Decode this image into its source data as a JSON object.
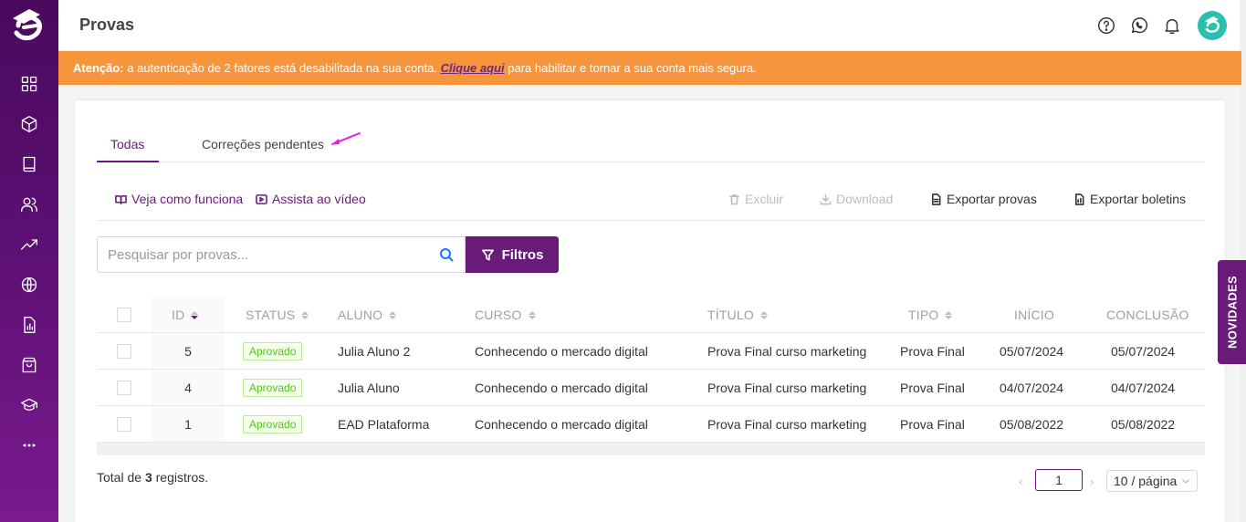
{
  "header": {
    "title": "Provas",
    "icons": [
      "help-circle-icon",
      "whatsapp-icon",
      "bell-icon"
    ]
  },
  "sidebar": {
    "items": [
      {
        "icon": "dashboard-icon"
      },
      {
        "icon": "cube-icon"
      },
      {
        "icon": "book-icon"
      },
      {
        "icon": "users-icon"
      },
      {
        "icon": "trend-up-icon"
      },
      {
        "icon": "globe-icon"
      },
      {
        "icon": "report-icon"
      },
      {
        "icon": "shopping-bag-icon"
      },
      {
        "icon": "graduation-cap-icon"
      },
      {
        "icon": "more-icon"
      }
    ]
  },
  "alert": {
    "label": "Atenção:",
    "text": "a autenticação de 2 fatores está desabilitada na sua conta.",
    "link": "Clique aqui",
    "suffix": "para habilitar e tornar a sua conta mais segura."
  },
  "tabs": {
    "all": "Todas",
    "pending": "Correções pendentes"
  },
  "toolbar": {
    "how_it_works": "Veja como funciona",
    "watch_video": "Assista ao vídeo",
    "delete": "Excluir",
    "download": "Download",
    "export_exams": "Exportar provas",
    "export_reports": "Exportar boletins"
  },
  "search": {
    "placeholder": "Pesquisar por provas...",
    "filter_label": "Filtros"
  },
  "table": {
    "columns": {
      "id": "ID",
      "status": "STATUS",
      "aluno": "ALUNO",
      "curso": "CURSO",
      "titulo": "TÍTULO",
      "tipo": "TIPO",
      "inicio": "INÍCIO",
      "conclusao": "CONCLUSÃO"
    },
    "rows": [
      {
        "id": "5",
        "status": "Aprovado",
        "aluno": "Julia Aluno 2",
        "curso": "Conhecendo o mercado digital",
        "titulo": "Prova Final curso marketing",
        "tipo": "Prova Final",
        "inicio": "05/07/2024",
        "conclusao": "05/07/2024"
      },
      {
        "id": "4",
        "status": "Aprovado",
        "aluno": "Julia Aluno",
        "curso": "Conhecendo o mercado digital",
        "titulo": "Prova Final curso marketing",
        "tipo": "Prova Final",
        "inicio": "04/07/2024",
        "conclusao": "04/07/2024"
      },
      {
        "id": "1",
        "status": "Aprovado",
        "aluno": "EAD Plataforma",
        "curso": "Conhecendo o mercado digital",
        "titulo": "Prova Final curso marketing",
        "tipo": "Prova Final",
        "inicio": "05/08/2022",
        "conclusao": "05/08/2022"
      }
    ]
  },
  "footer": {
    "total_prefix": "Total de",
    "total_count": "3",
    "total_suffix": "registros.",
    "current_page": "1",
    "page_size": "10 / página"
  },
  "side_tab": "NOVIDADES",
  "colors": {
    "primary": "#6a1b7a",
    "alert": "#f7953d",
    "success": "#52c41a"
  }
}
